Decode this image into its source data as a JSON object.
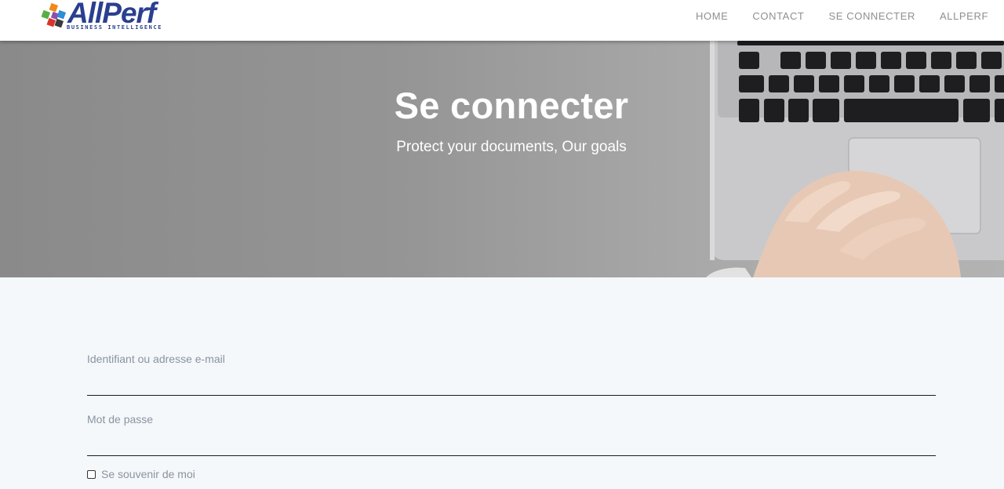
{
  "brand": {
    "name": "AllPerf",
    "tagline": "BUSINESS INTELLIGENCE",
    "colors": {
      "primary": "#2a3f8f",
      "tile_orange": "#f08a1c",
      "tile_blue": "#2b8fd6",
      "tile_green": "#55b044",
      "tile_red": "#d8342c",
      "tile_purple": "#8c4fb0"
    }
  },
  "nav": {
    "items": [
      {
        "label": "HOME"
      },
      {
        "label": "CONTACT"
      },
      {
        "label": "SE CONNECTER"
      },
      {
        "label": "ALLPERF"
      }
    ]
  },
  "hero": {
    "title": "Se connecter",
    "subtitle": "Protect your documents, Our goals",
    "image": "laptop-keyboard-and-clasped-hands-photo"
  },
  "login_form": {
    "username": {
      "label": "Identifiant ou adresse e-mail",
      "value": ""
    },
    "password": {
      "label": "Mot de passe",
      "value": ""
    },
    "remember": {
      "label": "Se souvenir de moi",
      "checked": false
    }
  }
}
